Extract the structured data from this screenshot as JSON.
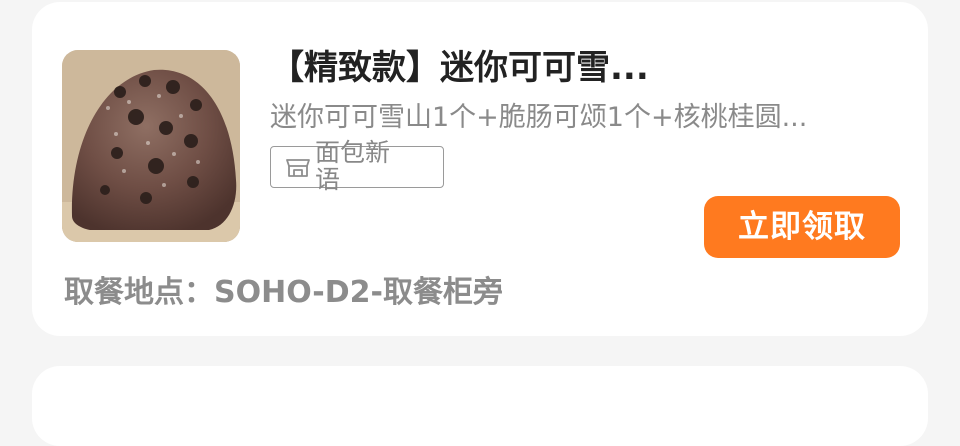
{
  "item": {
    "title": "【精致款】迷你可可雪...",
    "description": "迷你可可雪山1个+脆肠可颂1个+核桃桂圆...",
    "store_name": "面包新语",
    "claim_label": "立即领取",
    "pickup_location": "取餐地点：SOHO-D2-取餐柜旁",
    "image_alt": "迷你可可雪山"
  },
  "colors": {
    "accent": "#ff7a1f",
    "page_bg": "#f5f5f5",
    "card_bg": "#ffffff",
    "title_text": "#222222",
    "secondary_text": "#8a8a8a"
  },
  "icons": {
    "store": "store-icon"
  }
}
